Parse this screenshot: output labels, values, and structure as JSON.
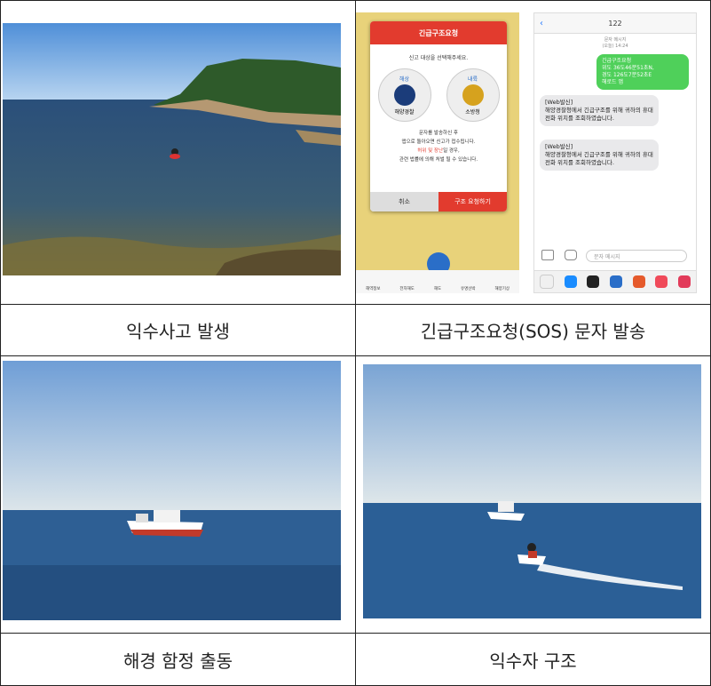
{
  "cells": [
    {
      "caption": "익수사고 발생"
    },
    {
      "caption": "긴급구조요청(SOS) 문자 발송"
    },
    {
      "caption": "해경 함정 출동"
    },
    {
      "caption": "익수자 구조"
    }
  ],
  "sos_app": {
    "title": "긴급구조요청",
    "subtitle": "신고 대상을 선택해주세요.",
    "badge_left_top": "해상",
    "badge_left_name": "해양경찰",
    "badge_right_top": "내륙",
    "badge_right_name": "소방청",
    "line1": "문자를 발송하신 후",
    "line2": "앱으로 돌아오면 신고가 접수됩니다.",
    "line3_red": "허위 및 장난",
    "line3_rest": "일 경우,",
    "line4": "관련 법률에 의해 처벌 될 수 있습니다.",
    "cancel": "취소",
    "request": "구조 요청하기",
    "nav": [
      "해역정보",
      "전자해도",
      "해도",
      "유명선박",
      "해양기상"
    ]
  },
  "sms": {
    "number": "122",
    "meta1": "문자 메시지",
    "meta2": "(오늘) 14:24",
    "outgoing": "긴급구조요청\n위도 36도46분51초N,\n경도 126도7분52초E\n해로드 앱",
    "incoming1": "[Web발신]\n해양경찰청에서 긴급구조를 위해 귀하의 휴대전화 위치를 조회하였습니다.",
    "incoming2": "[Web발신]\n해양경찰청에서 긴급구조를 위해 귀하의 휴대전화 위치를 조회하였습니다.",
    "input_placeholder": "문자 메시지"
  }
}
